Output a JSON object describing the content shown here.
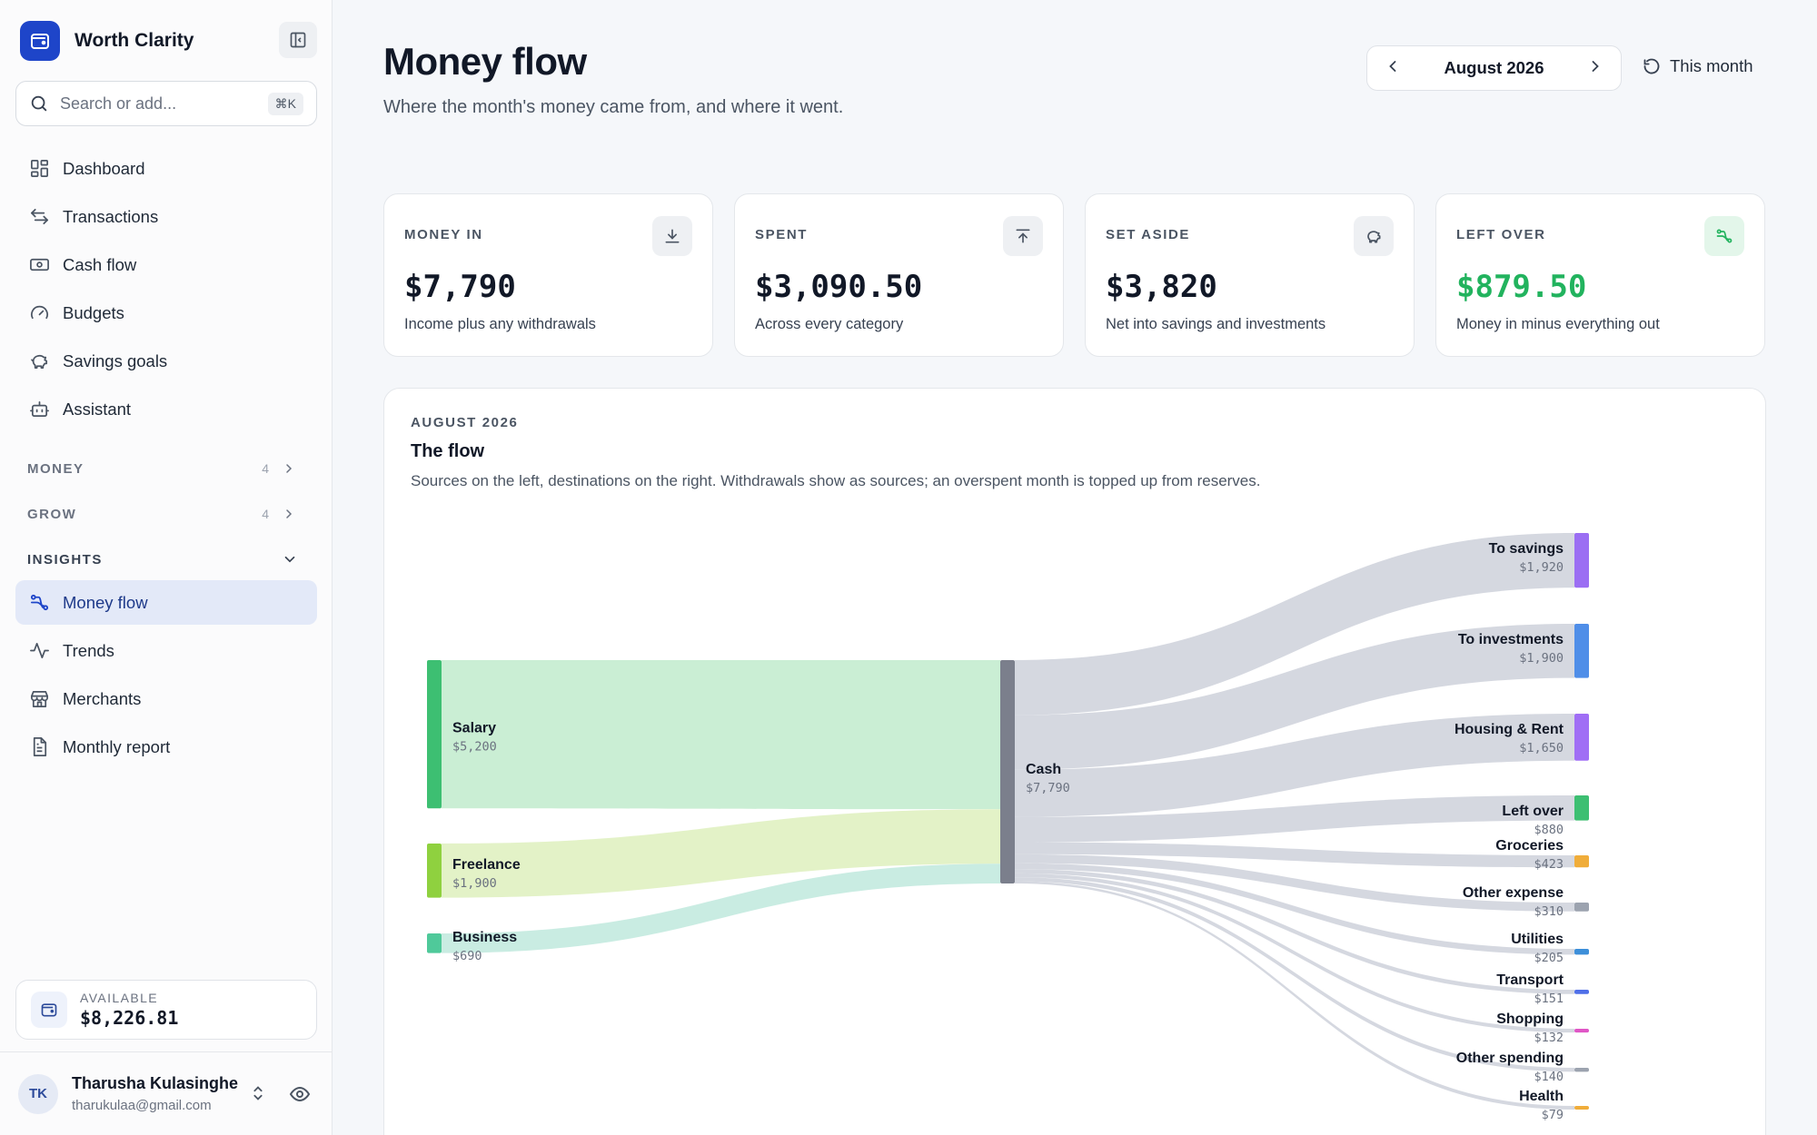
{
  "app": {
    "name": "Worth Clarity"
  },
  "search": {
    "placeholder": "Search or add...",
    "shortcut": "⌘K"
  },
  "sidebar": {
    "items": [
      {
        "label": "Dashboard",
        "icon": "dashboard-icon"
      },
      {
        "label": "Transactions",
        "icon": "arrows-icon"
      },
      {
        "label": "Cash flow",
        "icon": "banknote-icon"
      },
      {
        "label": "Budgets",
        "icon": "gauge-icon"
      },
      {
        "label": "Savings goals",
        "icon": "piggy-bank-icon"
      },
      {
        "label": "Assistant",
        "icon": "bot-icon"
      }
    ],
    "sections": [
      {
        "label": "MONEY",
        "count": "4"
      },
      {
        "label": "GROW",
        "count": "4"
      },
      {
        "label": "INSIGHTS"
      }
    ],
    "insights": [
      {
        "label": "Money flow",
        "icon": "flow-icon",
        "active": true
      },
      {
        "label": "Trends",
        "icon": "activity-icon"
      },
      {
        "label": "Merchants",
        "icon": "store-icon"
      },
      {
        "label": "Monthly report",
        "icon": "file-icon"
      }
    ],
    "available": {
      "label": "AVAILABLE",
      "value": "$8,226.81"
    },
    "user": {
      "initials": "TK",
      "name": "Tharusha Kulasinghe",
      "email": "tharukulaa@gmail.com"
    }
  },
  "header": {
    "title": "Money flow",
    "subtitle": "Where the month's money came from, and where it went.",
    "month": "August 2026",
    "this_month": "This month"
  },
  "cards": [
    {
      "label": "MONEY IN",
      "value": "$7,790",
      "desc": "Income plus any withdrawals",
      "icon": "download-icon"
    },
    {
      "label": "SPENT",
      "value": "$3,090.50",
      "desc": "Across every category",
      "icon": "upload-icon"
    },
    {
      "label": "SET ASIDE",
      "value": "$3,820",
      "desc": "Net into savings and investments",
      "icon": "piggy-bank-icon"
    },
    {
      "label": "LEFT OVER",
      "value": "$879.50",
      "desc": "Money in minus everything out",
      "icon": "flow-icon",
      "accent": "#22b35e"
    }
  ],
  "flow": {
    "eyebrow": "AUGUST 2026",
    "title": "The flow",
    "description": "Sources on the left, destinations on the right. Withdrawals show as sources; an overspent month is topped up from reserves."
  },
  "chart_data": {
    "type": "sankey",
    "hub": {
      "label": "Cash",
      "value": 7790,
      "display": "$7,790",
      "color": "#7b7f8c"
    },
    "sources": [
      {
        "label": "Salary",
        "value": 5200,
        "display": "$5,200",
        "color": "#3dbf72",
        "flow_color": "#c7edd2"
      },
      {
        "label": "Freelance",
        "value": 1900,
        "display": "$1,900",
        "color": "#8fd13f",
        "flow_color": "#e2f1c4"
      },
      {
        "label": "Business",
        "value": 690,
        "display": "$690",
        "color": "#4fc99a",
        "flow_color": "#c6ebe0"
      }
    ],
    "targets": [
      {
        "label": "To savings",
        "value": 1920,
        "display": "$1,920",
        "color": "#9b6ef3"
      },
      {
        "label": "To investments",
        "value": 1900,
        "display": "$1,900",
        "color": "#4f8ee8"
      },
      {
        "label": "Housing & Rent",
        "value": 1650,
        "display": "$1,650",
        "color": "#a06ef5"
      },
      {
        "label": "Left over",
        "value": 880,
        "display": "$880",
        "color": "#3dbf72"
      },
      {
        "label": "Groceries",
        "value": 423,
        "display": "$423",
        "color": "#f0ad3a"
      },
      {
        "label": "Other expense",
        "value": 310,
        "display": "$310",
        "color": "#9ca3af"
      },
      {
        "label": "Utilities",
        "value": 205,
        "display": "$205",
        "color": "#3d8fd9"
      },
      {
        "label": "Transport",
        "value": 151,
        "display": "$151",
        "color": "#4f6fe8"
      },
      {
        "label": "Shopping",
        "value": 132,
        "display": "$132",
        "color": "#e056c6"
      },
      {
        "label": "Other spending",
        "value": 140,
        "display": "$140",
        "color": "#9ca3af"
      },
      {
        "label": "Health",
        "value": 79,
        "display": "$79",
        "color": "#f0ad3a"
      }
    ],
    "out_flow_color": "#d3d6de"
  }
}
